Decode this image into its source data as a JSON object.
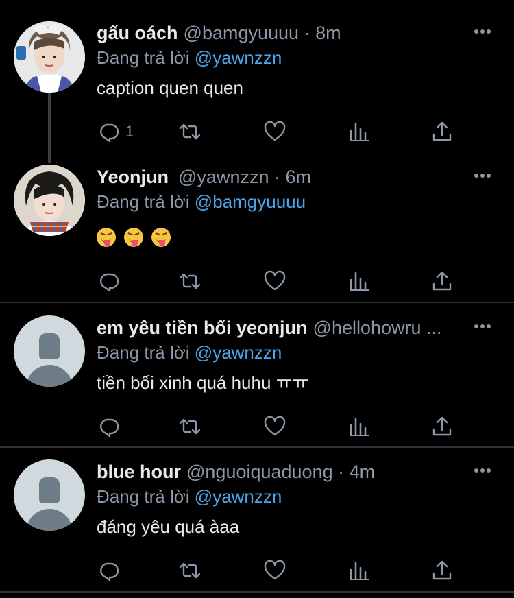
{
  "tweets": [
    {
      "name": "gấu oách",
      "handle": "@bamgyuuuu",
      "dot": "·",
      "time": "8m",
      "replying_prefix": "Đang trả lời",
      "replying_to": "@yawnzzn",
      "content": "caption quen quen",
      "reply_count": "1",
      "avatar": "photo"
    },
    {
      "name": "Yeonjun",
      "handle": "@yawnzzn",
      "dot": "·",
      "time": "6m",
      "replying_prefix": "Đang trả lời",
      "replying_to": "@bamgyuuuu",
      "content": "",
      "reply_count": "",
      "avatar": "photo"
    },
    {
      "name": "em yêu tiền bối yeonjun",
      "handle": "@hellohowru ...",
      "dot": "",
      "time": "",
      "replying_prefix": "Đang trả lời",
      "replying_to": "@yawnzzn",
      "content": "tiền bối xinh quá huhu ㅠㅠ",
      "reply_count": "",
      "avatar": "default"
    },
    {
      "name": "blue hour",
      "handle": "@nguoiquaduong",
      "dot": "·",
      "time": "4m",
      "replying_prefix": "Đang trả lời",
      "replying_to": "@yawnzzn",
      "content": "đáng yêu quá àaa",
      "reply_count": "",
      "avatar": "default"
    }
  ],
  "icons": {
    "reply": "reply-icon",
    "retweet": "retweet-icon",
    "like": "like-icon",
    "analytics": "analytics-icon",
    "share": "share-icon",
    "more": "more-icon"
  },
  "colors": {
    "background": "#000000",
    "text": "#e7e9ea",
    "muted": "#8b98a5",
    "mention": "#4ea4e8",
    "divider": "#2f3336"
  }
}
